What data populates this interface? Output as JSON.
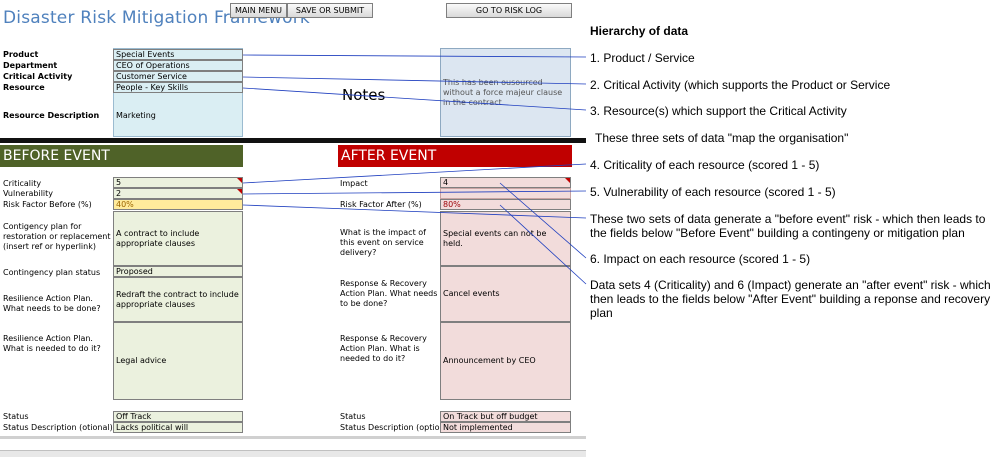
{
  "title": "Disaster Risk Mitigation Framework",
  "buttons": {
    "main_menu": "MAIN MENU",
    "save_or_submit": "SAVE OR SUBMIT",
    "risk_log": "GO TO RISK LOG"
  },
  "labels": {
    "product": "Product",
    "department": "Department",
    "critical_activity": "Critical Activity",
    "resource": "Resource",
    "resource_description": "Resource Description",
    "notes": "Notes"
  },
  "values": {
    "product": "Special Events",
    "department": "CEO of Operations",
    "critical_activity": "Customer Service",
    "resource": "People - Key Skills",
    "resource_description": "Marketing",
    "notes": "This has been ousourced without a force majeur clause in the contract"
  },
  "before": {
    "header": "BEFORE EVENT",
    "criticality_label": "Criticality",
    "criticality": "5",
    "vulnerability_label": "Vulnerability",
    "vulnerability": "2",
    "risk_label": "Risk Factor Before (%)",
    "risk": "40%",
    "contingency_label": "Contigency plan for restoration or replacement (insert ref or hyperlink)",
    "contingency": "A contract to include appropriate clauses",
    "contingency_status_label": "Contingency plan status",
    "contingency_status": "Proposed",
    "resilience1_label": "Resilience Action Plan. What needs to be done?",
    "resilience1": "Redraft the contract to include appropriate clauses",
    "resilience2_label": "Resilience Action Plan. What is needed to do it?",
    "resilience2": "Legal advice",
    "status_label": "Status",
    "status": "Off Track",
    "status_desc_label": "Status Description (otional)",
    "status_desc": "Lacks political will"
  },
  "after": {
    "header": "AFTER EVENT",
    "impact_label": "Impact",
    "impact": "4",
    "risk_label": "Risk Factor After (%)",
    "risk": "80%",
    "service_label": "What is the impact of this event on service delivery?",
    "service": "Special events can not be held.",
    "response1_label": "Response & Recovery Action Plan. What needs to be done?",
    "response1": "Cancel events",
    "response2_label": "Response & Recovery Action Plan. What is needed to do it?",
    "response2": "Announcement by CEO",
    "status_label": "Status",
    "status": "On Track but off budget",
    "status_desc_label": "Status Description (optiona",
    "status_desc": "Not implemented"
  },
  "hierarchy": {
    "heading": "Hierarchy of data",
    "items": [
      "1. Product / Service",
      "2. Critical Activity (which supports the Product or Service",
      "3. Resource(s) which support the Critical Activity",
      "These three sets of data \"map the organisation\"",
      "4. Criticality of each resource (scored 1 - 5)",
      "5. Vulnerability of each resource (scored 1 - 5)",
      "These two sets of data generate a \"before event\" risk - which then leads to the fields below \"Before Event\" building a contingeny or mitigation plan",
      "6. Impact on each resource (scored 1 - 5)",
      "Data sets 4 (Criticality) and 6 (Impact) generate an \"after event\" risk - which then leads to the fields below \"After Event\" building a reponse and recovery plan"
    ]
  },
  "colors": {
    "title": "#4f81bd",
    "before_header": "#4f6228",
    "after_header": "#c00000",
    "blue_cell": "#daeef3",
    "green_cell": "#ebf1de",
    "pink_cell": "#f2dcdb",
    "connector": "#1f3fbf"
  }
}
